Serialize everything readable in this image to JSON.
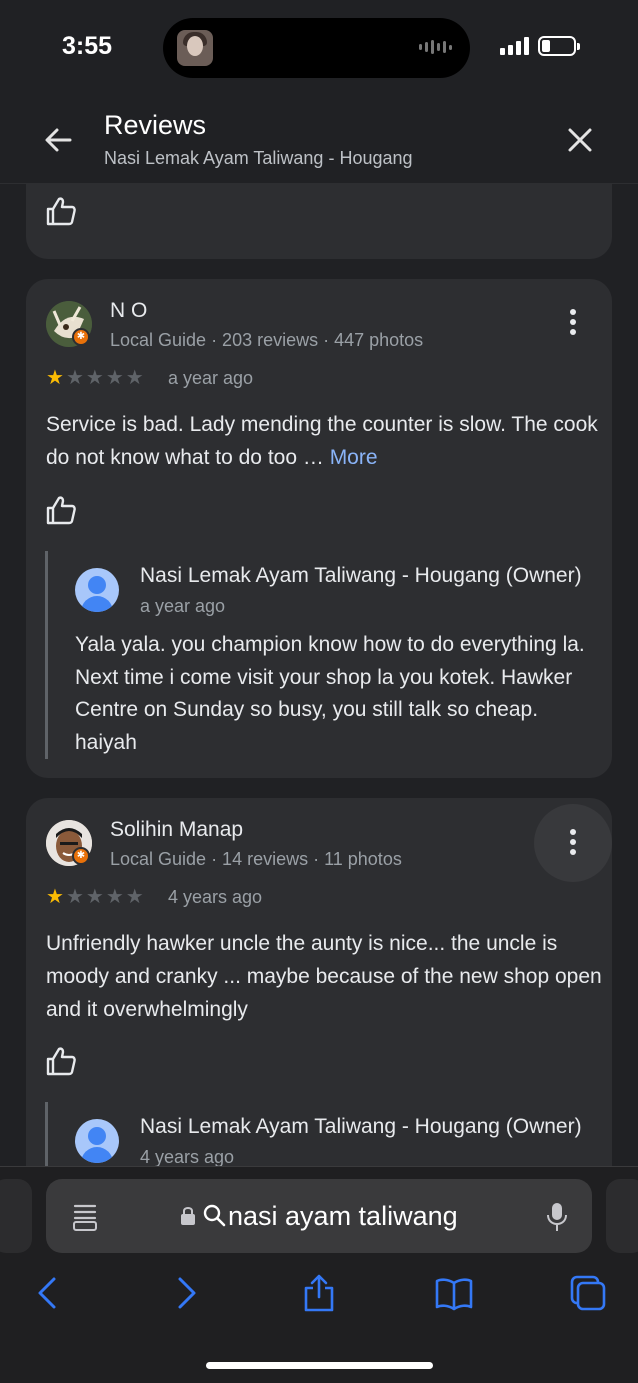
{
  "status_bar": {
    "time": "3:55"
  },
  "header": {
    "title": "Reviews",
    "subtitle": "Nasi Lemak Ayam Taliwang - Hougang"
  },
  "reviews": [
    {
      "author": "N O",
      "meta": "Local Guide · 203 reviews · 447 photos",
      "rating": 1,
      "time": "a year ago",
      "text": "Service is bad. Lady mending the counter is slow. The cook do not know what to do too …",
      "more_label": "More",
      "reply": {
        "name": "Nasi Lemak Ayam Taliwang - Hougang (Owner)",
        "time": "a year ago",
        "text": "Yala yala. you champion know how to do everything la. Next time i come visit your shop la you kotek. Hawker Centre on Sunday so busy, you still talk so cheap. haiyah"
      }
    },
    {
      "author": "Solihin Manap",
      "meta": "Local Guide · 14 reviews · 11 photos",
      "rating": 1,
      "time": "4 years ago",
      "text": "Unfriendly hawker uncle the aunty is nice... the uncle is moody and cranky ... maybe because of the new shop open and it overwhelmingly",
      "reply": {
        "name": "Nasi Lemak Ayam Taliwang - Hougang (Owner)",
        "time": "4 years ago"
      }
    }
  ],
  "browser": {
    "url_text": "nasi ayam taliwang",
    "accent_color": "#3478f6"
  },
  "icons": {
    "back": "arrow-left-icon",
    "close": "close-icon",
    "like": "thumbs-up-icon",
    "more": "more-vert-icon",
    "lock": "lock-icon",
    "search": "search-icon",
    "mic": "microphone-icon",
    "reader": "reader-icon",
    "share": "share-icon",
    "bookmarks": "book-icon",
    "tabs": "tabs-icon"
  }
}
